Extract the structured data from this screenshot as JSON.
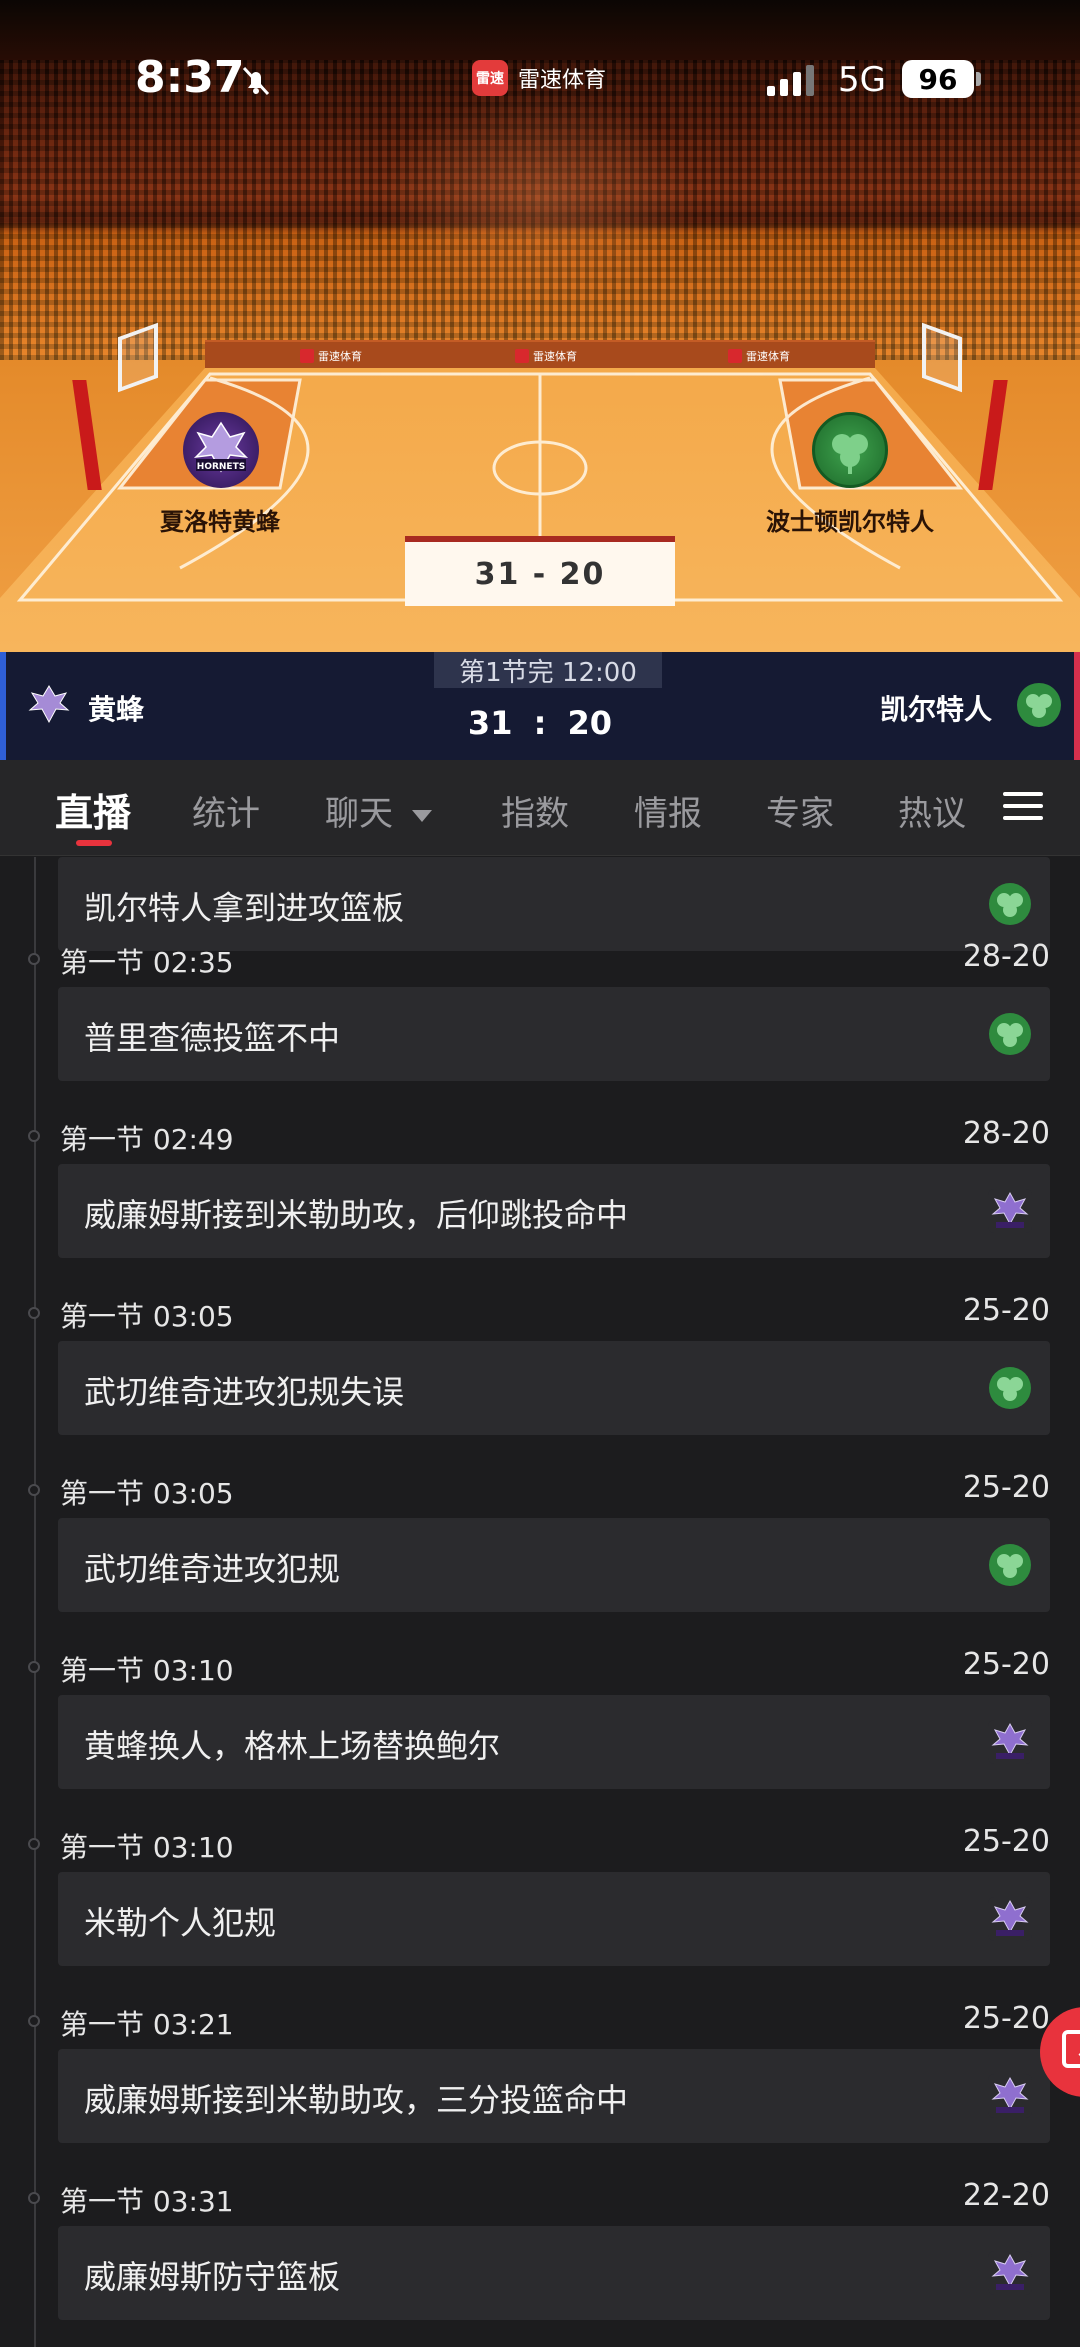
{
  "status_bar": {
    "time": "8:37",
    "app_badge_logo": "雷速",
    "app_name": "雷速体育",
    "network": "5G",
    "battery": "96"
  },
  "arena": {
    "ad_text": [
      "雷速体育",
      "雷速体育",
      "雷速体育"
    ],
    "home_team": "夏洛特黄蜂",
    "away_team": "波士顿凯尔特人",
    "home_logo_text": "HORNETS",
    "score": "31 - 20"
  },
  "score_bar": {
    "period": "第1节完 12:00",
    "home_short": "黄蜂",
    "away_short": "凯尔特人",
    "score": "31 : 20"
  },
  "tabs": {
    "items": [
      "直播",
      "统计",
      "聊天",
      "指数",
      "情报",
      "专家",
      "热议"
    ]
  },
  "feed": {
    "top_card": {
      "text": "凯尔特人拿到进攻篮板",
      "team": "celtics"
    },
    "entries": [
      {
        "meta": "第一节 02:35",
        "score": "28-20",
        "text": "普里查德投篮不中",
        "team": "celtics"
      },
      {
        "meta": "第一节 02:49",
        "score": "28-20",
        "text": "威廉姆斯接到米勒助攻，后仰跳投命中",
        "team": "hornets"
      },
      {
        "meta": "第一节 03:05",
        "score": "25-20",
        "text": "武切维奇进攻犯规失误",
        "team": "celtics"
      },
      {
        "meta": "第一节 03:05",
        "score": "25-20",
        "text": "武切维奇进攻犯规",
        "team": "celtics"
      },
      {
        "meta": "第一节 03:10",
        "score": "25-20",
        "text": "黄蜂换人，格林上场替换鲍尔",
        "team": "hornets"
      },
      {
        "meta": "第一节 03:10",
        "score": "25-20",
        "text": "米勒个人犯规",
        "team": "hornets"
      },
      {
        "meta": "第一节 03:21",
        "score": "25-20",
        "text": "威廉姆斯接到米勒助攻，三分投篮命中",
        "team": "hornets"
      },
      {
        "meta": "第一节 03:31",
        "score": "22-20",
        "text": "威廉姆斯防守篮板",
        "team": "hornets"
      }
    ]
  },
  "colors": {
    "accent": "#e8333d",
    "hornets": "#5b2d8e",
    "celtics": "#2e8b3e",
    "score_bar_bg": "#151a33"
  },
  "icons": {
    "mute": "bell-slash-icon",
    "signal": "signal-icon",
    "chat_dropdown": "caret-down-icon",
    "menu": "hamburger-icon",
    "fab": "edit-icon"
  }
}
